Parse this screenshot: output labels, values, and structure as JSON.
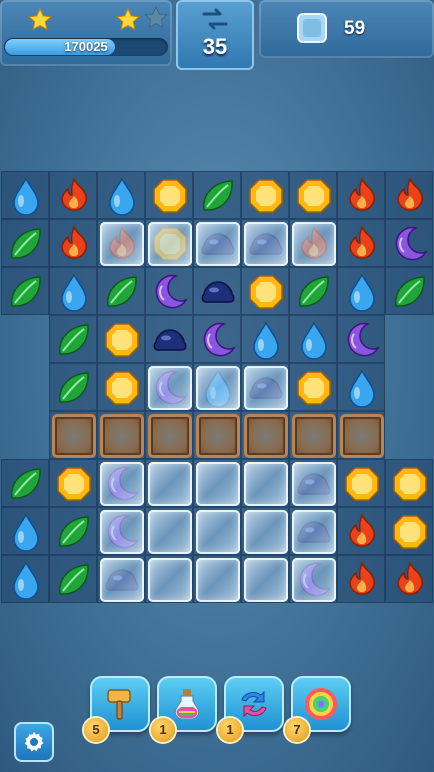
{
  "hud": {
    "score": "170025",
    "score_progress": 0.68,
    "stars_earned": 2,
    "stars_total": 3,
    "moves": "35",
    "goal_icon": "ice-block-icon",
    "goal_count": "59"
  },
  "colors": {
    "green": "#1fa53a",
    "red": "#e8421d",
    "blue": "#3aa6ef",
    "yellow": "#ffb812",
    "navy": "#1f2e7a",
    "purple": "#8b55e0"
  },
  "board": {
    "rows": [
      [
        "blue",
        "red",
        "blue",
        "yellow",
        "green",
        "yellow",
        "yellow",
        "red",
        "red"
      ],
      [
        "green",
        "red",
        "red",
        "yellow",
        "navy",
        "navy",
        "red",
        "red",
        "purple"
      ],
      [
        "green",
        "blue",
        "green",
        "purple",
        "navy",
        "yellow",
        "green",
        "blue",
        "green"
      ],
      [
        null,
        "green",
        "yellow",
        "navy",
        "purple",
        "blue",
        "blue",
        "purple",
        null
      ],
      [
        null,
        "green",
        "yellow",
        "purple",
        "blue",
        "navy",
        "yellow",
        "blue",
        null
      ],
      [
        null,
        "crate",
        "crate",
        "crate",
        "crate",
        "crate",
        "crate",
        "crate",
        null
      ],
      [
        "green",
        "yellow",
        "purple",
        null,
        null,
        null,
        "navy",
        "yellow",
        "yellow"
      ],
      [
        "blue",
        "green",
        "purple",
        null,
        null,
        null,
        "navy",
        "red",
        "yellow"
      ],
      [
        "blue",
        "green",
        "navy",
        null,
        null,
        null,
        "purple",
        "red",
        "red"
      ]
    ],
    "ice": [
      [
        0,
        0,
        0,
        0,
        0,
        0,
        0,
        0,
        0
      ],
      [
        0,
        0,
        1,
        1,
        1,
        1,
        1,
        0,
        0
      ],
      [
        0,
        0,
        0,
        0,
        0,
        0,
        0,
        0,
        0
      ],
      [
        0,
        0,
        0,
        0,
        0,
        0,
        0,
        0,
        0
      ],
      [
        0,
        0,
        0,
        1,
        1,
        1,
        0,
        0,
        0
      ],
      [
        0,
        0,
        0,
        0,
        0,
        0,
        0,
        0,
        0
      ],
      [
        0,
        0,
        1,
        1,
        1,
        1,
        1,
        0,
        0
      ],
      [
        0,
        0,
        1,
        1,
        1,
        1,
        1,
        0,
        0
      ],
      [
        0,
        0,
        1,
        1,
        1,
        1,
        1,
        0,
        0
      ]
    ]
  },
  "boosters": [
    {
      "icon": "hammer-icon",
      "count": "5"
    },
    {
      "icon": "potion-icon",
      "count": "1"
    },
    {
      "icon": "swap-arrows-icon",
      "count": "1"
    },
    {
      "icon": "rainbow-swirl-icon",
      "count": "7"
    }
  ],
  "settings_icon": "gear-icon"
}
